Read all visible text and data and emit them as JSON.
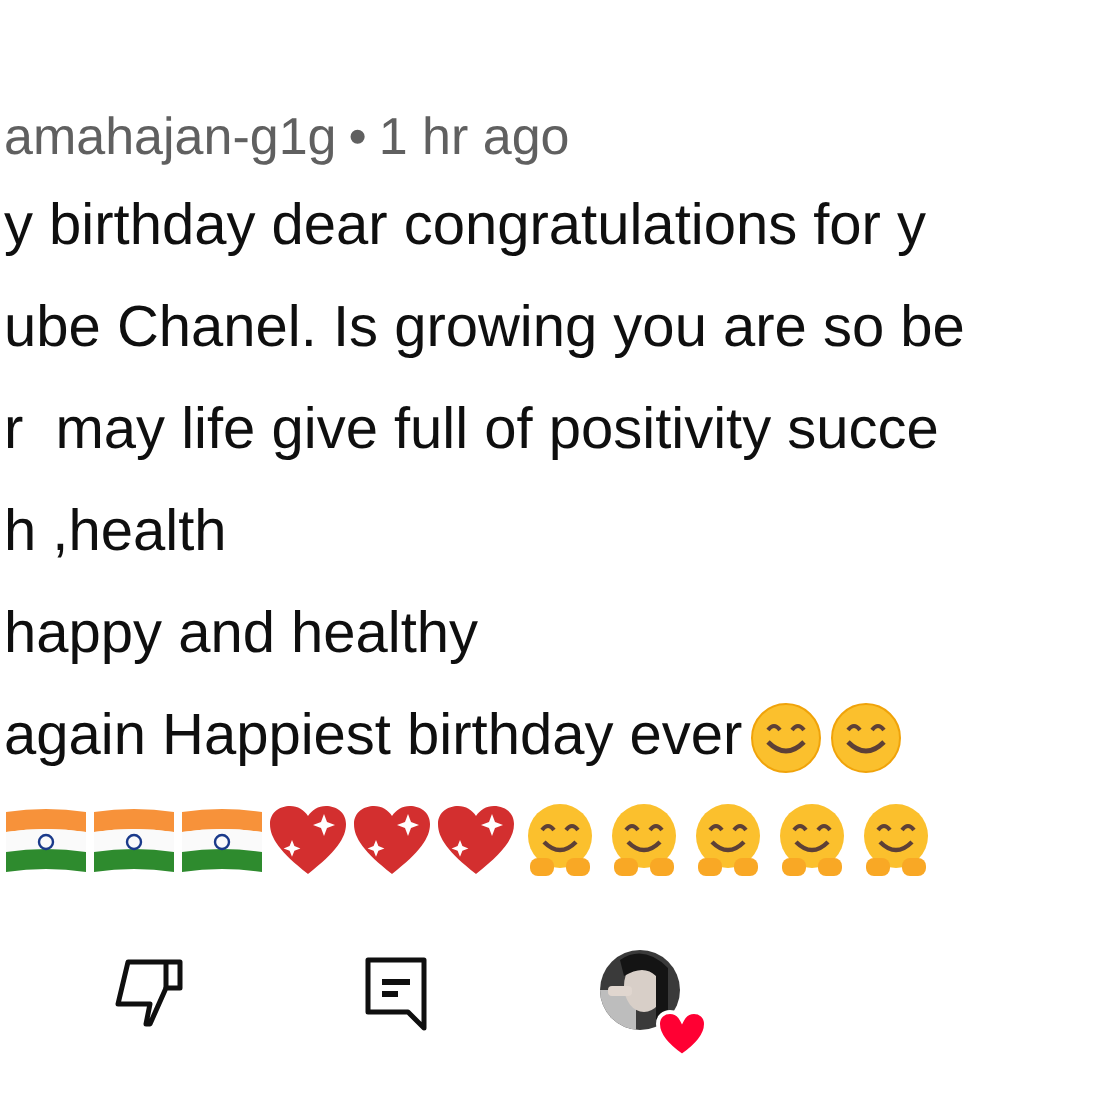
{
  "comment": {
    "author": "amahajan-g1g",
    "separator": "•",
    "time": "1 hr ago",
    "lines": [
      {
        "text": "y birthday dear congratulations for y"
      },
      {
        "text": "ube Chanel. Is growing you are so be"
      },
      {
        "text": "r  may life give full of positivity succe"
      },
      {
        "text": "h ,health"
      },
      {
        "text": "happy and healthy"
      },
      {
        "text": "again Happiest birthday ever",
        "emojis": [
          {
            "kind": "smile"
          },
          {
            "kind": "smile"
          }
        ]
      }
    ],
    "emoji_line": [
      {
        "kind": "flag"
      },
      {
        "kind": "flag"
      },
      {
        "kind": "flag"
      },
      {
        "kind": "heart"
      },
      {
        "kind": "heart"
      },
      {
        "kind": "heart"
      },
      {
        "kind": "hug"
      },
      {
        "kind": "hug"
      },
      {
        "kind": "hug"
      },
      {
        "kind": "hug"
      },
      {
        "kind": "hug"
      }
    ],
    "creator_heart": true
  }
}
